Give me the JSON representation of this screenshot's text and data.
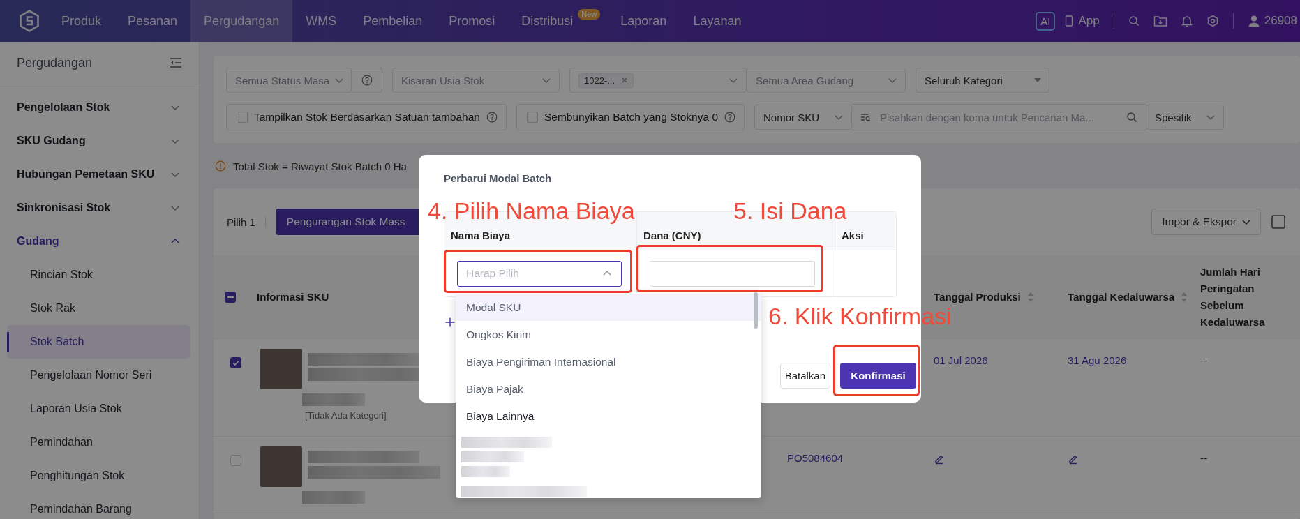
{
  "top_nav": {
    "items": [
      {
        "label": "Produk",
        "selected": false
      },
      {
        "label": "Pesanan",
        "selected": false
      },
      {
        "label": "Pergudangan",
        "selected": true
      },
      {
        "label": "WMS",
        "selected": false
      },
      {
        "label": "Pembelian",
        "selected": false
      },
      {
        "label": "Promosi",
        "selected": false
      },
      {
        "label": "Distribusi",
        "selected": false,
        "badge": "New"
      },
      {
        "label": "Laporan",
        "selected": false
      },
      {
        "label": "Layanan",
        "selected": false
      }
    ],
    "ai_button": "AI",
    "app_button": "App",
    "user": "26908"
  },
  "sidebar": {
    "title": "Pergudangan",
    "groups": [
      {
        "label": "Pengelolaan Stok",
        "expanded": false,
        "selected": false
      },
      {
        "label": "SKU Gudang",
        "expanded": false,
        "selected": false
      },
      {
        "label": "Hubungan Pemetaan SKU",
        "expanded": false,
        "selected": false
      },
      {
        "label": "Sinkronisasi Stok",
        "expanded": false,
        "selected": false
      },
      {
        "label": "Gudang",
        "expanded": true,
        "selected": true,
        "children": [
          {
            "label": "Rincian Stok",
            "selected": false
          },
          {
            "label": "Stok Rak",
            "selected": false
          },
          {
            "label": "Stok Batch",
            "selected": true
          },
          {
            "label": "Pengelolaan Nomor Seri",
            "selected": false
          },
          {
            "label": "Laporan Usia Stok",
            "selected": false
          },
          {
            "label": "Pemindahan",
            "selected": false
          },
          {
            "label": "Penghitungan Stok",
            "selected": false
          },
          {
            "label": "Pemindahan Barang",
            "selected": false
          }
        ]
      }
    ]
  },
  "filters": {
    "status_select": {
      "placeholder": "Semua Status Masa"
    },
    "age_select": {
      "placeholder": "Kisaran Usia Stok"
    },
    "batch_select": {
      "tags": [
        "1022-..."
      ]
    },
    "area_select": {
      "placeholder": "Semua Area Gudang"
    },
    "category_select": {
      "value": "Seluruh Kategori"
    },
    "checkboxes": [
      {
        "label": "Tampilkan Stok Berdasarkan Satuan tambahan",
        "checked": false
      },
      {
        "label": "Sembunyikan Batch yang Stoknya 0",
        "checked": false
      }
    ],
    "search_type": {
      "value": "Nomor SKU"
    },
    "search": {
      "placeholder": "Pisahkan dengan koma untuk Pencarian Ma..."
    },
    "match_mode": {
      "value": "Spesifik"
    }
  },
  "notice": "Total Stok = Riwayat Stok Batch 0 Ha",
  "table": {
    "selected_count": "Pilih 1",
    "bulk_button": "Pengurangan Stok Mass",
    "import_export": "Impor & Ekspor",
    "select_all_partial": true,
    "columns": [
      {
        "label": "Informasi SKU",
        "sortable": false
      },
      {
        "label": "Tanggal Produksi",
        "sortable": true
      },
      {
        "label": "Tanggal Kedaluwarsa",
        "sortable": true
      },
      {
        "label": "Jumlah Hari Peringatan Sebelum Kedaluwarsa",
        "sortable": false
      }
    ],
    "rows": [
      {
        "checked": true,
        "category": "[Tidak Ada Kategori]",
        "editable": false,
        "production_date": "01 Jul 2026",
        "expiry_date": "31 Agu 2026",
        "warning_days": "--"
      },
      {
        "checked": false,
        "po_number": "PO5084604",
        "editable": true,
        "warning_days": "--"
      }
    ]
  },
  "modal": {
    "title": "Perbarui Modal Batch",
    "columns": [
      "Nama Biaya",
      "Dana (CNY)",
      "Aksi"
    ],
    "cost_select": {
      "placeholder": "Harap Pilih",
      "expanded": true
    },
    "buttons": [
      {
        "label": "Batalkan",
        "kind": "secondary"
      },
      {
        "label": "Konfirmasi",
        "kind": "primary"
      }
    ],
    "dropdown": {
      "options": [
        {
          "label": "Modal SKU",
          "selected": true,
          "hovered": false
        },
        {
          "label": "Ongkos Kirim",
          "selected": false,
          "hovered": false
        },
        {
          "label": "Biaya Pengiriman Internasional",
          "selected": false,
          "hovered": false
        },
        {
          "label": "Biaya Pajak",
          "selected": false,
          "hovered": false
        },
        {
          "label": "Biaya Lainnya",
          "selected": false,
          "hovered": true
        }
      ]
    }
  },
  "annotations": [
    {
      "label": "4. Pilih Nama Biaya"
    },
    {
      "label": "5. Isi Dana"
    },
    {
      "label": "6. Klik Konfirmasi"
    }
  ]
}
